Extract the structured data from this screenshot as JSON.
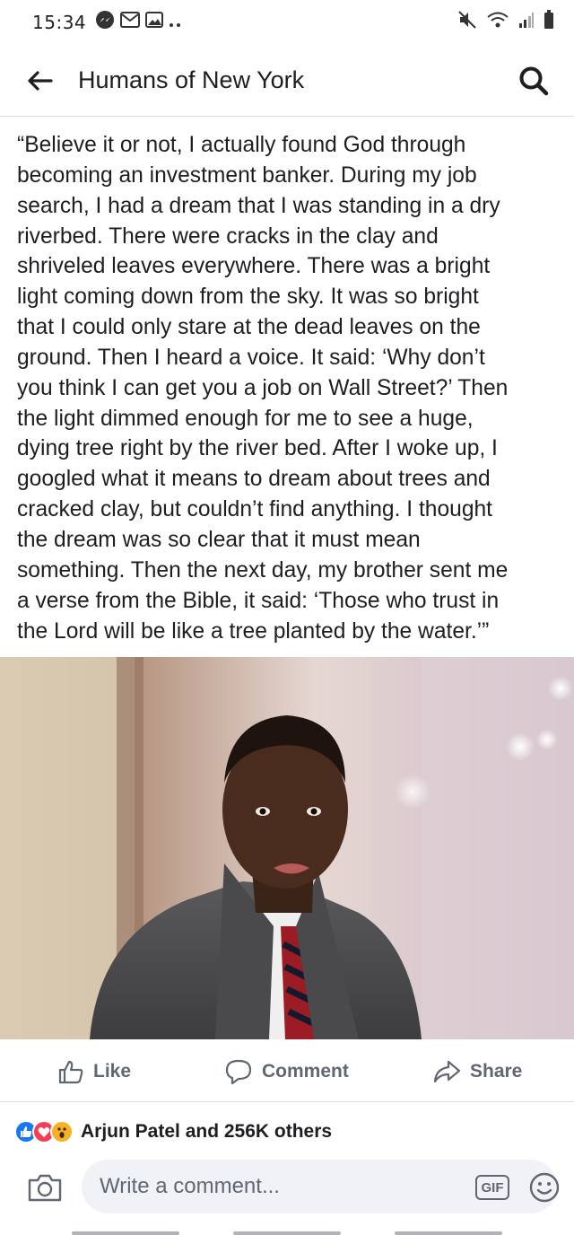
{
  "status_bar": {
    "time": "15:34",
    "left_icons": [
      "messenger-icon",
      "gmail-icon",
      "gallery-icon",
      "more-dots-icon"
    ],
    "right_icons": [
      "mute-icon",
      "wifi-icon",
      "signal-icon",
      "battery-icon"
    ]
  },
  "header": {
    "title": "Humans of New York"
  },
  "post": {
    "text": "“Believe it or not, I actually found God through\nbecoming an investment banker.  During my job\nsearch, I had a dream that I was standing in a dry\nriverbed.  There were cracks in the clay and\nshriveled leaves everywhere.  There was a bright\nlight coming down from the sky.  It was so bright\nthat I could only stare at the dead leaves on the\nground.  Then I heard a voice.  It said: ‘Why don’t\nyou think I can get you a job on Wall Street?’  Then\nthe light dimmed enough for me to see a huge,\ndying tree right by the river bed.  After I woke up, I\ngoogled what it means to dream about trees and\ncracked clay, but couldn’t find anything.  I thought\nthe dream was so clear that it must mean\nsomething.  Then the next day, my brother sent me\na verse from the Bible, it said: ‘Those who trust in\nthe Lord will be like a tree planted by the water.’”"
  },
  "actions": {
    "like_label": "Like",
    "comment_label": "Comment",
    "share_label": "Share"
  },
  "reactions": {
    "icons": [
      "like-reaction-icon",
      "love-reaction-icon",
      "wow-reaction-icon"
    ],
    "summary": "Arjun Patel and 256K others"
  },
  "comment_bar": {
    "placeholder": "Write a comment...",
    "gif_label": "GIF"
  },
  "colors": {
    "like_blue": "#1877f2",
    "love_red": "#f33e58",
    "wow_yellow": "#f7b125",
    "secondary_text": "#606770"
  }
}
